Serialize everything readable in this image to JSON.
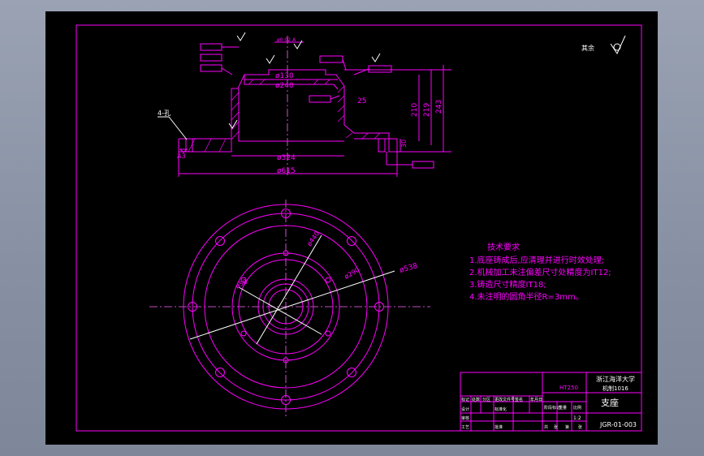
{
  "colors": {
    "background": "#000000",
    "lines": "#ff00ff",
    "text_white": "#ffffff",
    "window": "#8d95a6"
  },
  "roughness": {
    "label": "其余",
    "icon": "roughness-symbol-icon"
  },
  "section": {
    "dims": {
      "d130": "ø130",
      "d240": "ø240",
      "d324": "ø324",
      "d615": "ø615",
      "h25": "25",
      "h210": "210",
      "h219": "219",
      "h243": "243",
      "h30": "30",
      "a3": "A3",
      "tap_label": "4-孔",
      "top_callout": "ø0.02 A"
    }
  },
  "plan": {
    "dims": {
      "d538": "ø538",
      "d440": "ø440",
      "d290": "ø290",
      "d58": "ø58"
    }
  },
  "tech": {
    "title": "技术要求",
    "items": [
      "1.底座铸成后,应清理并进行时效处理;",
      "2.机械加工未注偏差尺寸处精度为IT12;",
      "3.铸造尺寸精度IT18;",
      "4.未注明的圆角半径R=3mm。"
    ]
  },
  "title_block": {
    "material": "HT250",
    "school": "浙江海洋大学",
    "class": "机制1016",
    "name": "支座",
    "drawing_no": "JGR-01-003",
    "scale": "1:2",
    "row1": [
      "标记",
      "处数",
      "分区",
      "更改文件号",
      "签名",
      "年月日"
    ],
    "row2": [
      "设计",
      "",
      "",
      "标准化",
      "",
      ""
    ],
    "row3": [
      "审核",
      "",
      "",
      ""
    ],
    "row4": [
      "工艺",
      "",
      "批准",
      ""
    ],
    "stage_labels": [
      "阶段标记",
      "重量",
      "比例"
    ],
    "sheet_labels": [
      "共",
      "张",
      "第",
      "张"
    ]
  }
}
